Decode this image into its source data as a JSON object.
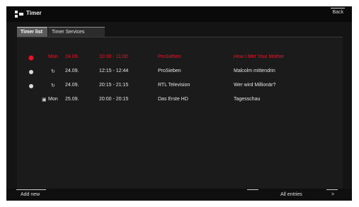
{
  "header": {
    "title": "Timer",
    "back_label": "Back"
  },
  "tabs": [
    {
      "label": "Timer list",
      "active": true
    },
    {
      "label": "Timer Services",
      "active": false
    }
  ],
  "timers": [
    {
      "day": "Mon",
      "date": "24.09.",
      "time": "10:30 - 11:00",
      "channel": "ProSieben",
      "title": "How I Met Your Mother",
      "status": "recording-dot",
      "highlight": true
    },
    {
      "day": "",
      "date": "24.09.",
      "time": "12:15 - 12:44",
      "channel": "ProSieben",
      "title": "Malcolm mittendrin",
      "status": "dot",
      "icon": "repeat-icon",
      "highlight": false
    },
    {
      "day": "",
      "date": "24.09.",
      "time": "20:15 - 21:15",
      "channel": "RTL Television",
      "title": "Wer wird Millionär?",
      "status": "dot",
      "icon": "repeat-icon",
      "highlight": false
    },
    {
      "day": "Mon",
      "date": "25.09.",
      "time": "20:00 - 20:15",
      "channel": "Das Erste HD",
      "title": "Tagesschau",
      "status": "none",
      "icon": "calendar-icon",
      "highlight": false
    }
  ],
  "footer": {
    "add_new": "Add new",
    "all_entries": "All entries",
    "next": ">"
  },
  "colors": {
    "accent_red": "#e0192b",
    "background": "#141414"
  }
}
